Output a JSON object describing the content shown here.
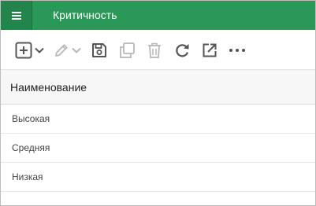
{
  "window": {
    "title": "Критичность"
  },
  "toolbar": {
    "buttons": [
      {
        "icon": "add-icon",
        "enabled": true,
        "has_dropdown": true
      },
      {
        "icon": "edit-icon",
        "enabled": false,
        "has_dropdown": true
      },
      {
        "icon": "save-icon",
        "enabled": true
      },
      {
        "icon": "copy-icon",
        "enabled": false
      },
      {
        "icon": "delete-icon",
        "enabled": false
      },
      {
        "icon": "refresh-icon",
        "enabled": true
      },
      {
        "icon": "open-external-icon",
        "enabled": true
      },
      {
        "icon": "more-icon",
        "enabled": true
      }
    ]
  },
  "grid": {
    "columns": [
      "Наименование"
    ],
    "rows": [
      [
        "Высокая"
      ],
      [
        "Средняя"
      ],
      [
        "Низкая"
      ]
    ]
  },
  "colors": {
    "titlebar": "#2a9957",
    "menu_button": "#23854b",
    "icon_active": "#555555",
    "icon_disabled": "#b8b8b8"
  }
}
